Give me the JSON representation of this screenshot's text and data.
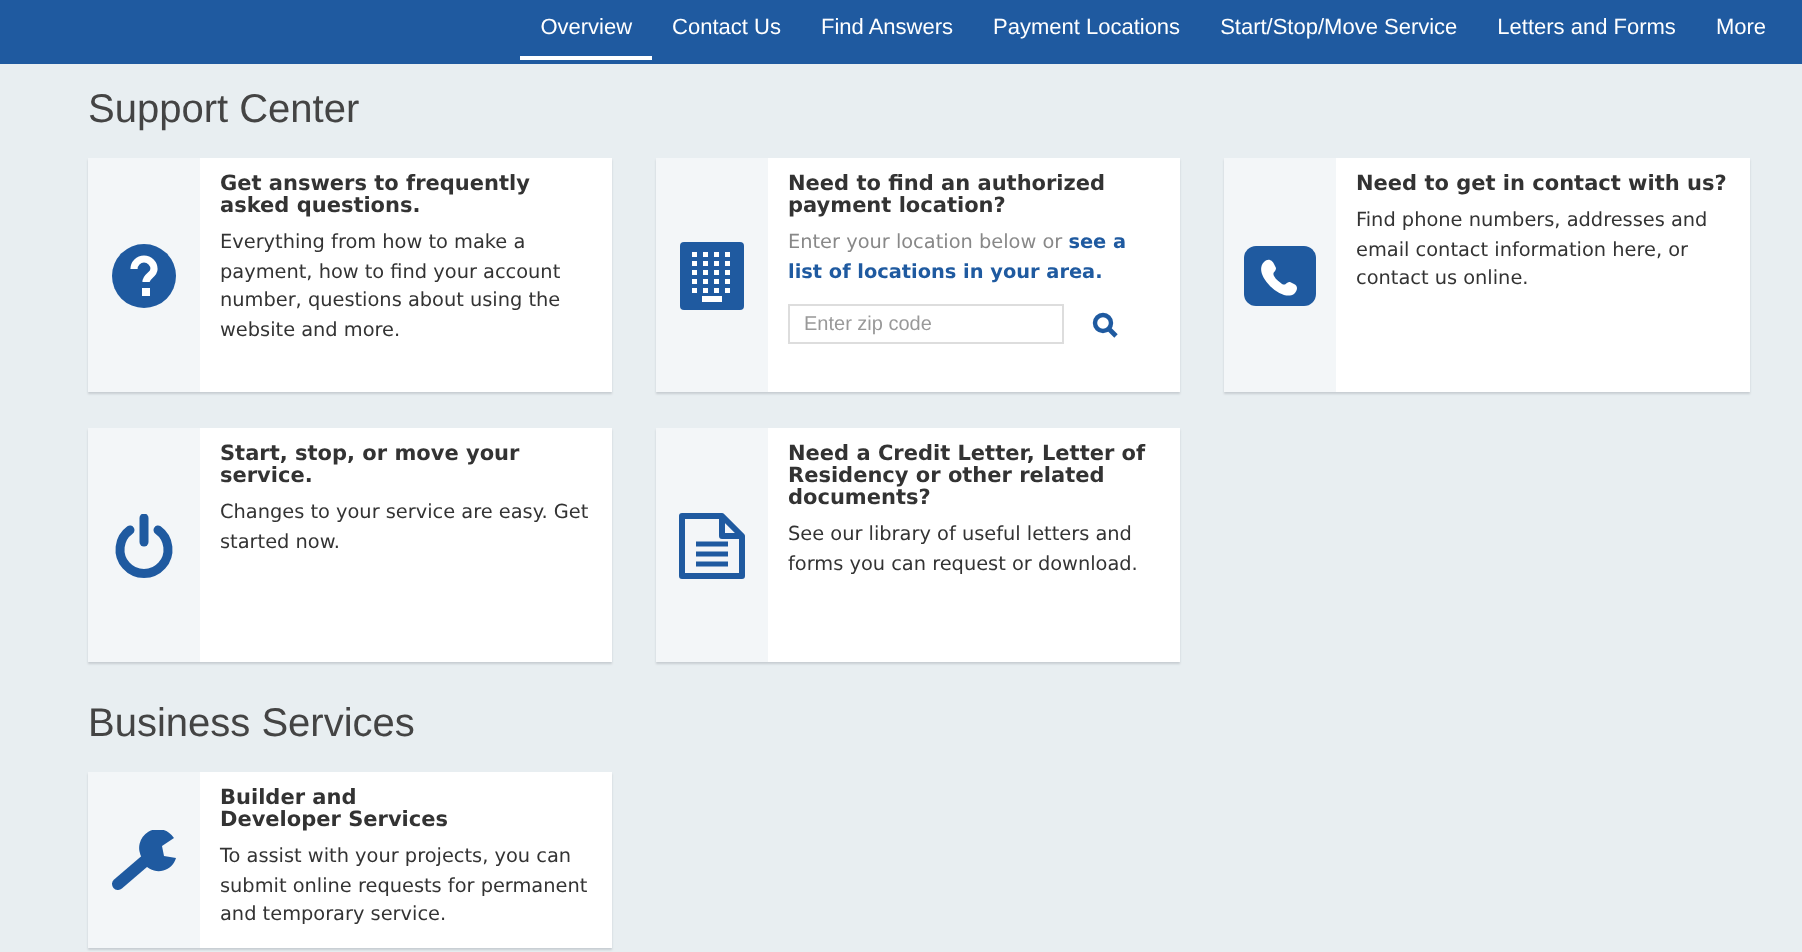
{
  "nav": [
    {
      "label": "Overview",
      "selected": true
    },
    {
      "label": "Contact Us",
      "selected": false
    },
    {
      "label": "Find Answers",
      "selected": false
    },
    {
      "label": "Payment Locations",
      "selected": false
    },
    {
      "label": "Start/Stop/Move Service",
      "selected": false
    },
    {
      "label": "Letters and Forms",
      "selected": false
    },
    {
      "label": "More",
      "selected": false
    }
  ],
  "sections": [
    {
      "title": "Support Center",
      "cards": [
        {
          "kind": "text",
          "title": "Get answers to frequently asked questions.",
          "text": "Everything from how to make a payment, how to find your account number, questions about using the website and more."
        },
        {
          "kind": "search",
          "title": "Need to find an authorized payment location?",
          "text": "Enter your location below or",
          "link": "see a list of locations in your area.",
          "field": {
            "placeholder": "Enter zip code"
          }
        },
        {
          "kind": "text",
          "title": "Need to get in contact with us?",
          "text": "Find phone numbers, addresses and email contact information here, or contact us online."
        },
        {
          "kind": "text",
          "title": "Start, stop, or move your service.",
          "text": "Changes to your service are easy. Get started now."
        },
        {
          "kind": "text",
          "title": "Need a Credit Letter, Letter of Residency or other related documents?",
          "text": "See our library of useful letters and forms you can request or download."
        }
      ]
    },
    {
      "title": "Business Services",
      "cards": [
        {
          "kind": "text",
          "title": "Builder and\nDeveloper Services",
          "text": "To assist with your projects, you can submit online requests for permanent and temporary service."
        }
      ]
    }
  ]
}
